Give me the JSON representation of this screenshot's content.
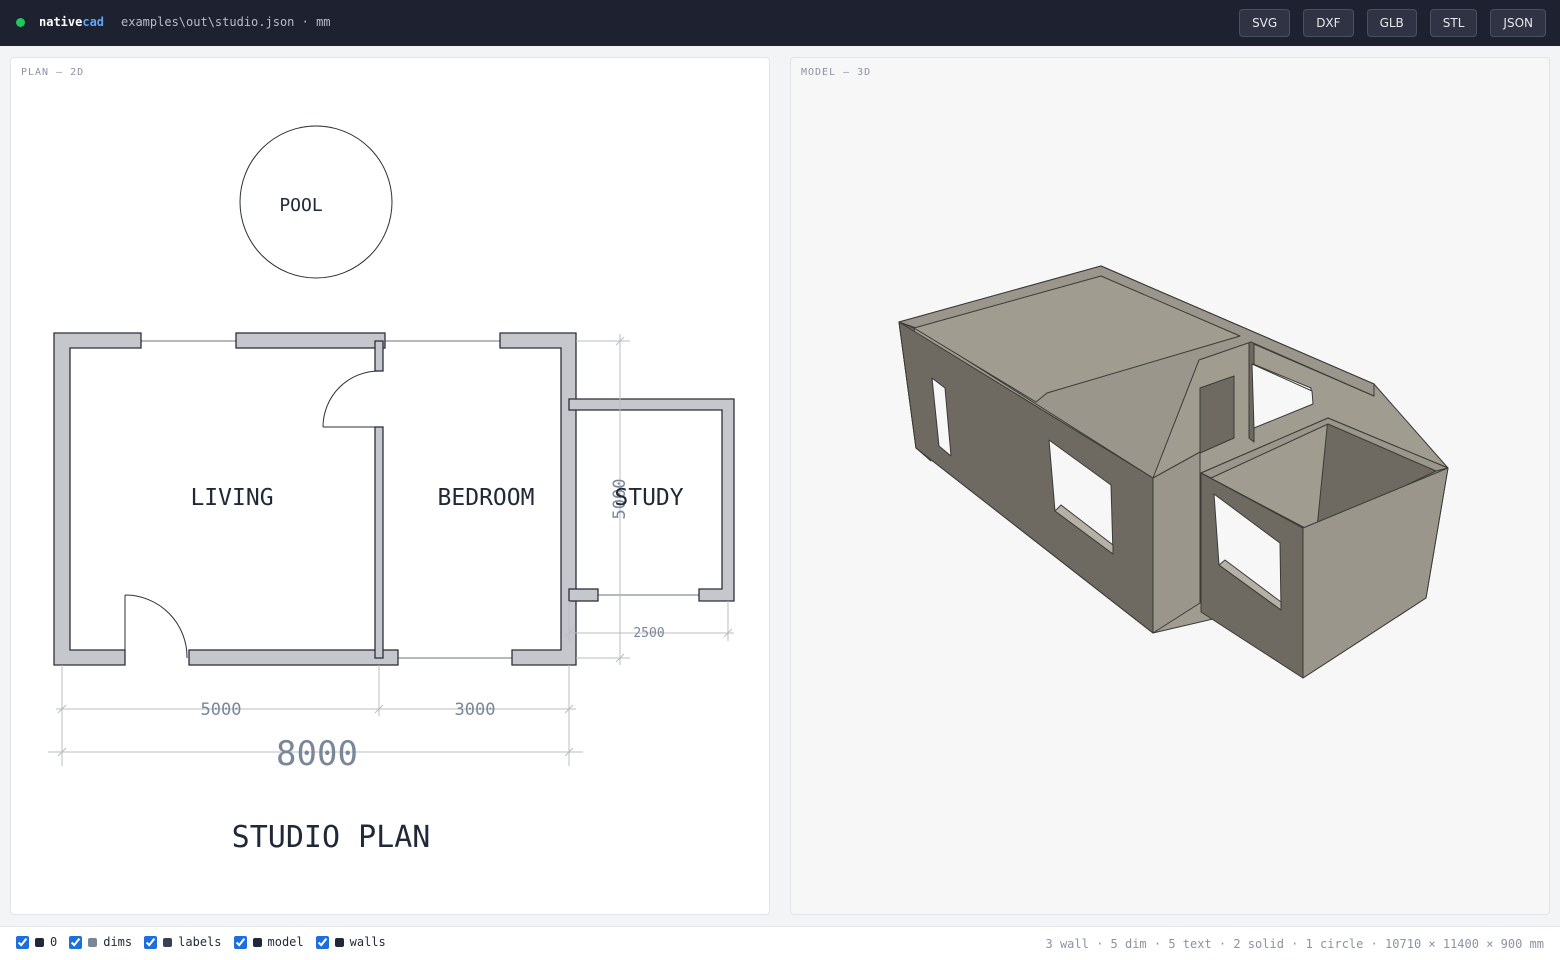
{
  "app": {
    "name_part1": "native",
    "name_part2": "cad",
    "status_color": "#22c55e"
  },
  "file": {
    "path": "examples\\out\\studio.json · mm"
  },
  "exports": [
    "SVG",
    "DXF",
    "GLB",
    "STL",
    "JSON"
  ],
  "plan": {
    "title": "PLAN — 2D",
    "labels": {
      "pool": "POOL",
      "living": "LIVING",
      "bedroom": "BEDROOM",
      "study": "STUDY",
      "drawing_title": "STUDIO PLAN"
    },
    "dims": {
      "living_width": "5000",
      "bedroom_width": "3000",
      "total_width": "8000",
      "study_width": "2500",
      "height": "5000"
    }
  },
  "model": {
    "title": "MODEL — 3D",
    "wall_color": "#9a968b"
  },
  "layers": [
    {
      "name": "0",
      "color": "#1f2937",
      "checked": true
    },
    {
      "name": "dims",
      "color": "#7a8799",
      "checked": true
    },
    {
      "name": "labels",
      "color": "#374151",
      "checked": true
    },
    {
      "name": "model",
      "color": "#1f2937",
      "checked": true
    },
    {
      "name": "walls",
      "color": "#1f2937",
      "checked": true
    }
  ],
  "stats": "3 wall · 5 dim · 5 text · 2 solid · 1 circle · 10710 × 11400 × 900 mm"
}
